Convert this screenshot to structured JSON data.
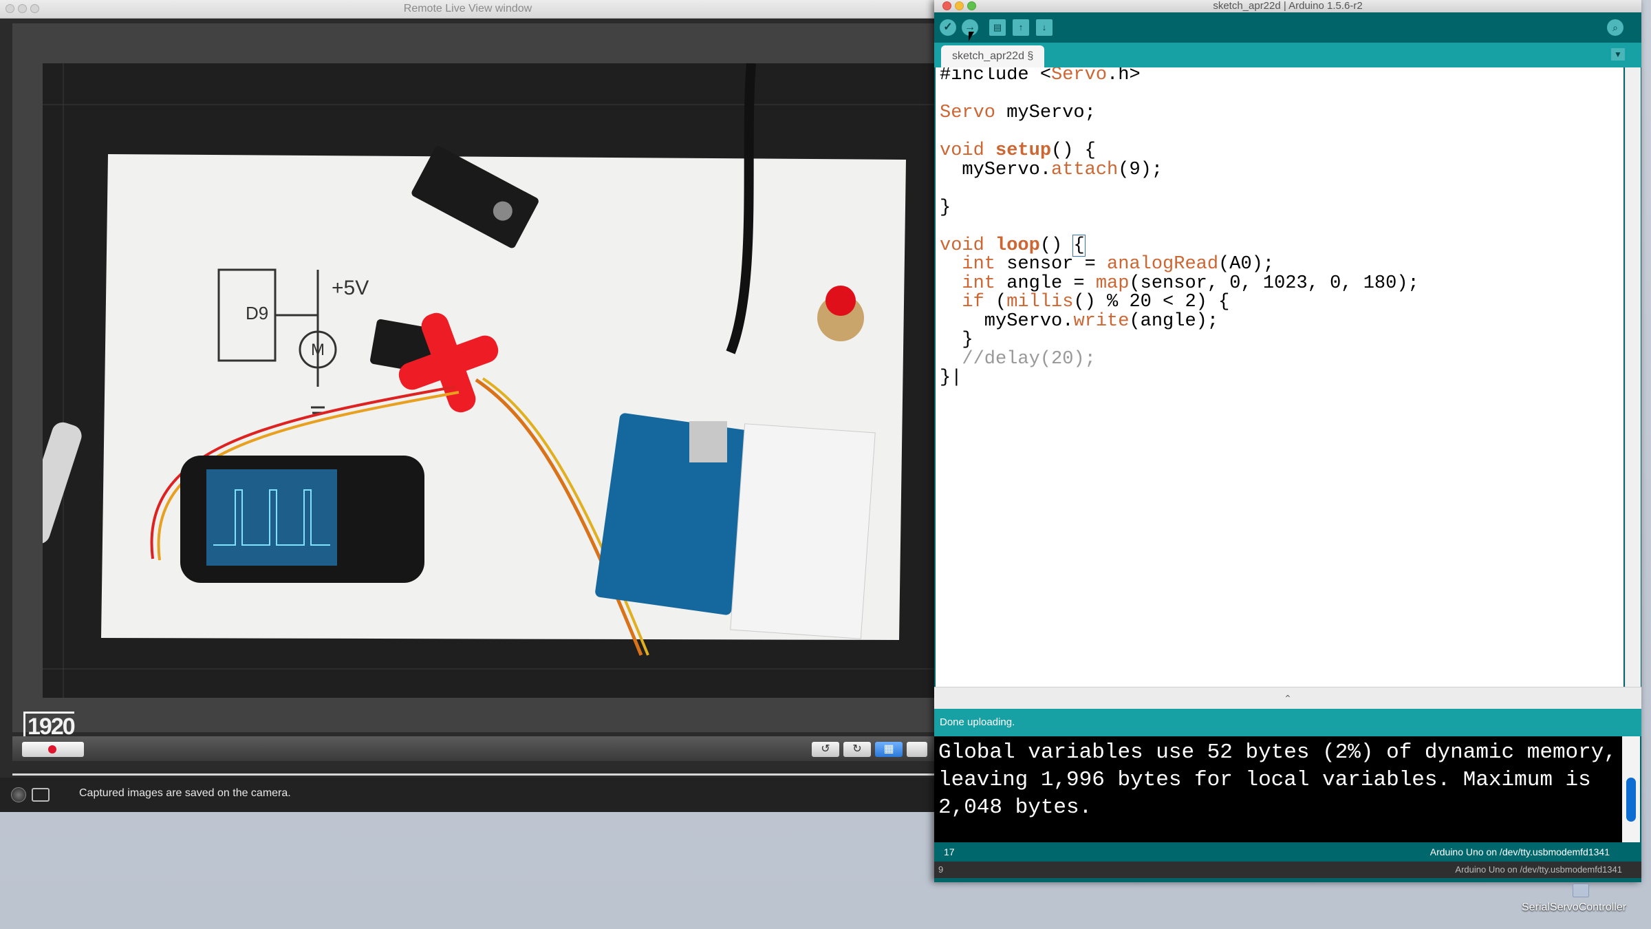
{
  "remote_live_view": {
    "title": "Remote Live View window",
    "resolution_badge": "1920",
    "status_text": "Captured images are saved on the camera.",
    "photo_annotations": {
      "d9": "D9",
      "v5": "+5V",
      "motor": "M"
    }
  },
  "ide": {
    "title": "sketch_apr22d | Arduino 1.5.6-r2",
    "tab_label": "sketch_apr22d §",
    "code_lines": [
      "#include <Servo.h>",
      "",
      "Servo myServo;",
      "",
      "void setup() {",
      "  myServo.attach(9);",
      "",
      "}",
      "",
      "void loop() {",
      "  int sensor = analogRead(A0);",
      "  int angle = map(sensor, 0, 1023, 0, 180);",
      "  if (millis() % 20 < 2) {",
      "    myServo.write(angle);",
      "  }",
      "  //delay(20);",
      "}"
    ],
    "message": "Done uploading.",
    "console_text": "Global variables use 52 bytes (2%) of dynamic memory, leaving 1,996 bytes for local variables. Maximum is 2,048 bytes.",
    "footer_line": "17",
    "footer_board": "Arduino Uno on /dev/tty.usbmodemfd1341",
    "footer2_line": "9",
    "footer2_board": "Arduino Uno on /dev/tty.usbmodemfd1341",
    "colors": {
      "toolbar_bg": "#006468",
      "tabbar_bg": "#17a1a5",
      "keyword": "#cc6633",
      "comment": "#999999"
    },
    "toolbar_icons": [
      "verify-icon",
      "upload-icon",
      "new-icon",
      "open-icon",
      "save-icon",
      "serial-monitor-icon"
    ]
  },
  "desktop": {
    "folder_label": "SerialServoController"
  }
}
